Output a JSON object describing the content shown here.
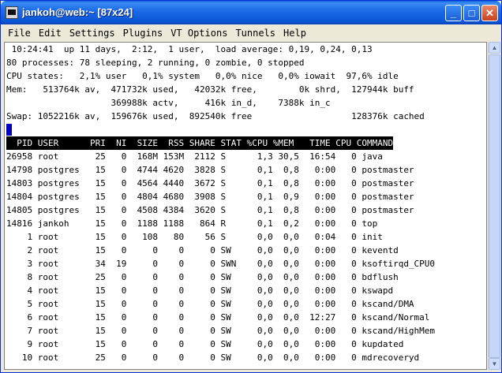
{
  "window": {
    "title": "jankoh@web:~ [87x24]"
  },
  "titlebar_buttons": {
    "minimize": "_",
    "maximize": "□",
    "close": "✕"
  },
  "menu": [
    "File",
    "Edit",
    "Settings",
    "Plugins",
    "VT Options",
    "Tunnels",
    "Help"
  ],
  "summary": [
    " 10:24:41  up 11 days,  2:12,  1 user,  load average: 0,19, 0,24, 0,13",
    "80 processes: 78 sleeping, 2 running, 0 zombie, 0 stopped",
    "CPU states:   2,1% user   0,1% system   0,0% nice   0,0% iowait  97,6% idle",
    "Mem:   513764k av,  471732k used,   42032k free,        0k shrd,  127944k buff",
    "                    369988k actv,     416k in_d,    7388k in_c",
    "Swap: 1052216k av,  159676k used,  892540k free                   128376k cached"
  ],
  "table_header": "  PID USER      PRI  NI  SIZE  RSS SHARE STAT %CPU %MEM   TIME CPU COMMAND",
  "processes": [
    "26958 root       25   0  168M 153M  2112 S      1,3 30,5  16:54   0 java",
    "14798 postgres   15   0  4744 4620  3828 S      0,1  0,8   0:00   0 postmaster",
    "14803 postgres   15   0  4564 4440  3672 S      0,1  0,8   0:00   0 postmaster",
    "14804 postgres   15   0  4804 4680  3908 S      0,1  0,9   0:00   0 postmaster",
    "14805 postgres   15   0  4508 4384  3620 S      0,1  0,8   0:00   0 postmaster",
    "14816 jankoh     15   0  1188 1188   864 R      0,1  0,2   0:00   0 top",
    "    1 root       15   0   108   80    56 S      0,0  0,0   0:04   0 init",
    "    2 root       15   0     0    0     0 SW     0,0  0,0   0:00   0 keventd",
    "    3 root       34  19     0    0     0 SWN    0,0  0,0   0:00   0 ksoftirqd_CPU0",
    "    8 root       25   0     0    0     0 SW     0,0  0,0   0:00   0 bdflush",
    "    4 root       15   0     0    0     0 SW     0,0  0,0   0:00   0 kswapd",
    "    5 root       15   0     0    0     0 SW     0,0  0,0   0:00   0 kscand/DMA",
    "    6 root       15   0     0    0     0 SW     0,0  0,0  12:27   0 kscand/Normal",
    "    7 root       15   0     0    0     0 SW     0,0  0,0   0:00   0 kscand/HighMem",
    "    9 root       15   0     0    0     0 SW     0,0  0,0   0:00   0 kupdated",
    "   10 root       25   0     0    0     0 SW     0,0  0,0   0:00   0 mdrecoveryd"
  ],
  "colors": {
    "titlebar": "#0a56d6",
    "terminal_bg": "#ffffff",
    "cursor": "#0000c0"
  }
}
